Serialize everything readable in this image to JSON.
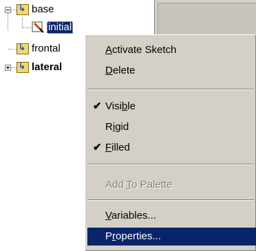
{
  "tree": {
    "items": [
      {
        "label": "base",
        "expanded": true
      },
      {
        "label": "initial",
        "selected": true
      },
      {
        "label": "frontal"
      },
      {
        "label": "lateral",
        "bold": true,
        "expanded": false
      }
    ]
  },
  "menu": {
    "items": [
      {
        "pre": "",
        "ul": "A",
        "post": "ctivate Sketch",
        "checked": false,
        "disabled": false
      },
      {
        "pre": "",
        "ul": "D",
        "post": "elete",
        "checked": false,
        "disabled": false
      },
      {
        "pre": "Visi",
        "ul": "b",
        "post": "le",
        "checked": true,
        "disabled": false
      },
      {
        "pre": "R",
        "ul": "i",
        "post": "gid",
        "checked": false,
        "disabled": false
      },
      {
        "pre": "",
        "ul": "F",
        "post": "illed",
        "checked": true,
        "disabled": false
      },
      {
        "pre": "Add ",
        "ul": "T",
        "post": "o Palette",
        "checked": false,
        "disabled": true
      },
      {
        "pre": "",
        "ul": "V",
        "post": "ariables...",
        "checked": false,
        "disabled": false
      },
      {
        "pre": "P",
        "ul": "r",
        "post": "operties...",
        "checked": false,
        "disabled": false,
        "highlighted": true
      }
    ],
    "check_glyph": "✔"
  },
  "colors": {
    "menu_bg": "#d4d0c8",
    "highlight": "#0a246a",
    "folder": "#f3d86a"
  }
}
